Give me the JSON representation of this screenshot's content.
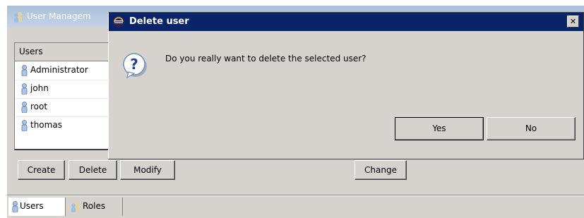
{
  "background_window": {
    "title": "User Managem",
    "users_header": "Users",
    "users": [
      "Administrator",
      "john",
      "root",
      "thomas"
    ],
    "buttons": {
      "create": "Create",
      "delete": "Delete",
      "modify": "Modify",
      "change": "Change"
    },
    "tabs": [
      {
        "label": "Users",
        "icon": "user-icon"
      },
      {
        "label": "Roles",
        "icon": "roles-icon"
      }
    ]
  },
  "dialog": {
    "title": "Delete user",
    "close_label": "✕",
    "message": "Do you really want to delete the selected user?",
    "icon": "question-icon",
    "yes_label": "Yes",
    "no_label": "No"
  },
  "colors": {
    "dialog_titlebar": "#0a246a",
    "window_face": "#d6d3ce",
    "inactive_titlebar": "#a9c0da"
  }
}
